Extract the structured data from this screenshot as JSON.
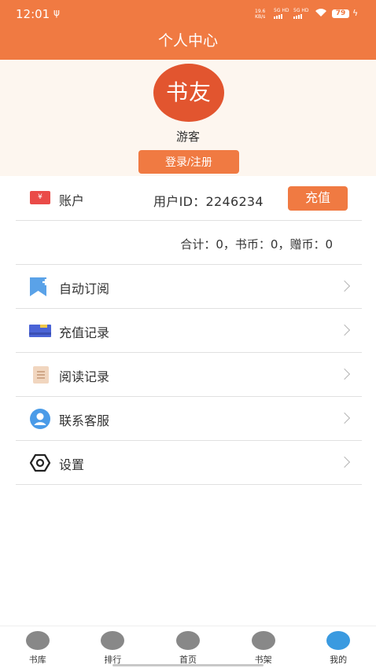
{
  "status_bar": {
    "time": "12:01",
    "usb": "ψ",
    "net_speed": "19.6",
    "net_unit": "KB/s",
    "sim1": "5G HD",
    "sim2": "5G HD",
    "battery": "79",
    "charging": "ϟ"
  },
  "header": {
    "title": "个人中心"
  },
  "profile": {
    "avatar_text": "书友",
    "username": "游客",
    "login_label": "登录/注册"
  },
  "account": {
    "icon_text": "¥",
    "label": "账户",
    "user_id": "用户ID：2246234",
    "recharge_label": "充值",
    "balance": "合计：0，书币：0，赠币：0"
  },
  "menu": [
    {
      "label": "自动订阅",
      "icon": "bookmark-plus-icon"
    },
    {
      "label": "充值记录",
      "icon": "wallet-card-icon"
    },
    {
      "label": "阅读记录",
      "icon": "book-history-icon"
    },
    {
      "label": "联系客服",
      "icon": "customer-service-icon"
    },
    {
      "label": "设置",
      "icon": "settings-hex-icon"
    }
  ],
  "tabs": [
    {
      "label": "书库",
      "icon": "library-icon",
      "active": false
    },
    {
      "label": "排行",
      "icon": "crown-icon",
      "active": false
    },
    {
      "label": "首页",
      "icon": "home-book-icon",
      "active": false
    },
    {
      "label": "书架",
      "icon": "bookshelf-icon",
      "active": false
    },
    {
      "label": "我的",
      "icon": "user-icon",
      "active": true
    }
  ],
  "colors": {
    "primary": "#f07a42",
    "avatar": "#e2552f",
    "profile_bg": "#fdf6ef",
    "active_tab": "#3a9ae0"
  }
}
